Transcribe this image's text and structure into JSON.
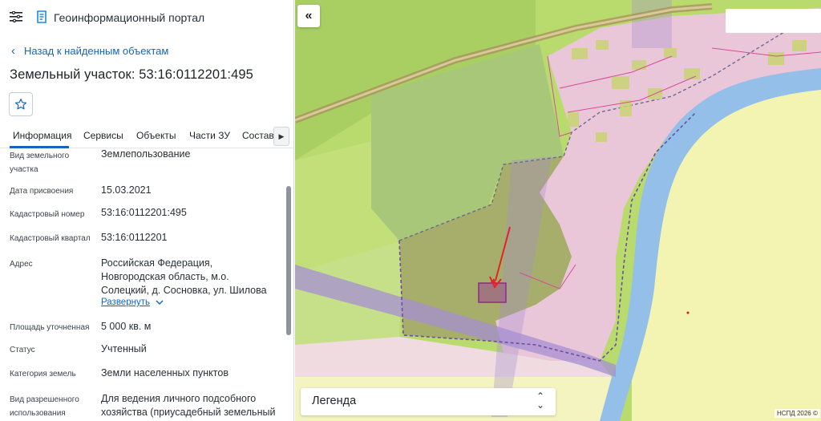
{
  "app": {
    "title": "Геоинформационный портал"
  },
  "nav": {
    "back_label": "Назад к найденным объектам"
  },
  "object": {
    "title": "Земельный участок: 53:16:0112201:495"
  },
  "tabs": [
    {
      "label": "Информация",
      "active": true
    },
    {
      "label": "Сервисы",
      "active": false
    },
    {
      "label": "Объекты",
      "active": false
    },
    {
      "label": "Части ЗУ",
      "active": false
    },
    {
      "label": "Состав",
      "active": false
    }
  ],
  "rows": [
    {
      "label_lines": [
        "Вид земельного",
        "участка"
      ],
      "value_lines": [
        "Землепользование"
      ]
    },
    {
      "label_lines": [
        "Дата присвоения"
      ],
      "value_lines": [
        "15.03.2021"
      ]
    },
    {
      "label_lines": [
        "Кадастровый номер"
      ],
      "value_lines": [
        "53:16:0112201:495"
      ]
    },
    {
      "label_lines": [
        "Кадастровый квартал"
      ],
      "value_lines": [
        "53:16:0112201"
      ]
    },
    {
      "label_lines": [
        "Адрес"
      ],
      "value_lines": [
        "Российская Федерация,",
        "Новгородская область, м.о.",
        "Солецкий, д. Сосновка, ул. Шилова"
      ]
    },
    {
      "label_lines": [
        "Площадь уточненная"
      ],
      "value_lines": [
        "5 000 кв. м"
      ]
    },
    {
      "label_lines": [
        "Статус"
      ],
      "value_lines": [
        "Учтенный"
      ]
    },
    {
      "label_lines": [
        "Категория земель"
      ],
      "value_lines": [
        "Земли населенных пунктов"
      ]
    },
    {
      "label_lines": [
        "Вид разрешенного",
        "использования"
      ],
      "value_lines": [
        "Для ведения личного подсобного",
        "хозяйства (приусадебный земельный"
      ]
    }
  ],
  "address_expand_label": "Развернуть",
  "map": {
    "legend_label": "Легенда",
    "copyright": "НСПД 2026 ©",
    "colors": {
      "residential_zone": "#eac6d9",
      "agricultural_zone": "#b9db6e",
      "light_zone": "#f3f3b2",
      "forest_zone": "#a7c27a",
      "river": "#93bfe8",
      "corridor": "#a58fd1",
      "parcel_highlight": "#9b4a8f",
      "pointer_arrow": "#e3222c"
    }
  },
  "icons": {
    "menu": "menu-icon",
    "logo": "logo-icon",
    "back": "chevron-left-icon",
    "favorite": "star-icon",
    "tabs_next": "chevron-right-icon",
    "expand": "chevron-down-icon",
    "collapse_panel": "double-chevron-left-icon",
    "legend_toggle": "up-down-arrows-icon"
  }
}
